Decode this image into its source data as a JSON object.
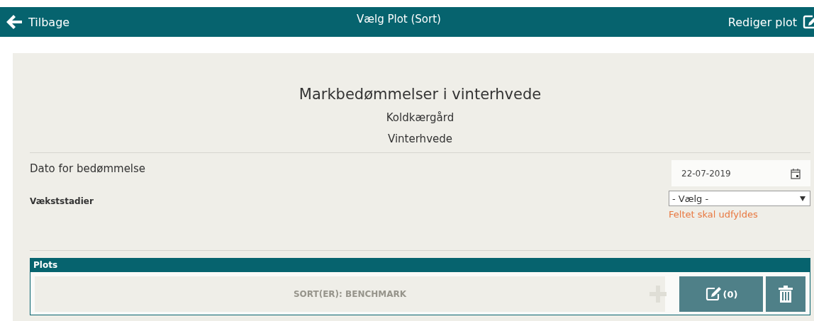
{
  "top_bar": {
    "back": "Tilbage",
    "title": "Vælg Plot (Sort)",
    "edit": "Rediger plot"
  },
  "header": {
    "title": "Markbedømmelser i vinterhvede",
    "farm": "Koldkærgård",
    "crop": "Vinterhvede"
  },
  "date_field": {
    "label": "Dato for bedømmelse",
    "value": "22-07-2019"
  },
  "growth_stage": {
    "label": "Vækststadier",
    "value": "- Vælg -",
    "error": "Feltet skal udfyldes"
  },
  "plots": {
    "title": "Plots",
    "items": [
      {
        "label": "SORT(ER): BENCHMARK",
        "disabled": true,
        "count": "(0)"
      }
    ]
  }
}
